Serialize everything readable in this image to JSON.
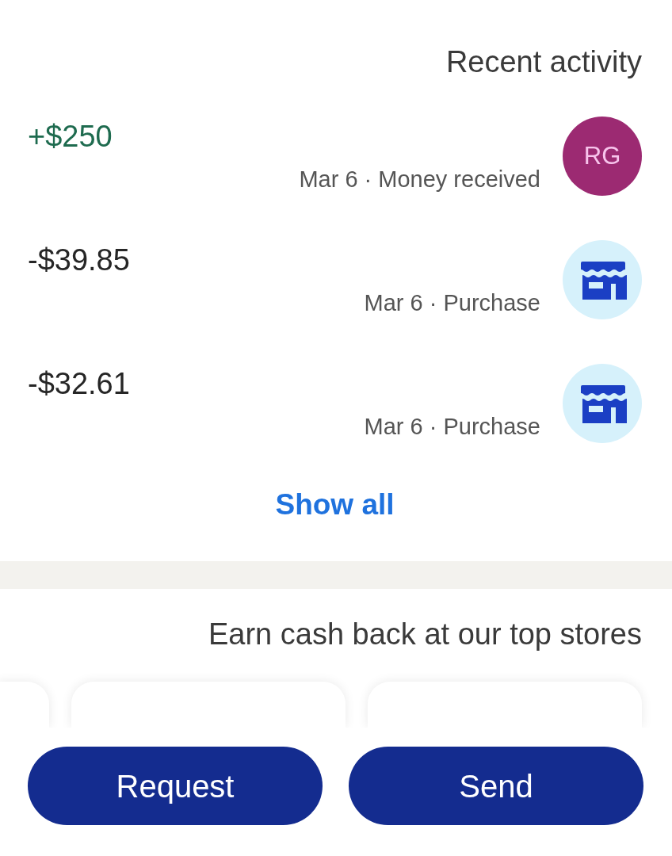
{
  "recent_activity": {
    "title": "Recent activity",
    "transactions": [
      {
        "kind": "person",
        "initials": "RG",
        "color": "#9c2a72",
        "amount": "+$250",
        "credit": true,
        "subtitle": "Mar 6 · Money received"
      },
      {
        "kind": "store",
        "amount": "-$39.85",
        "credit": false,
        "subtitle": "Mar 6 · Purchase"
      },
      {
        "kind": "store",
        "amount": "-$32.61",
        "credit": false,
        "subtitle": "Mar 6 · Purchase"
      }
    ],
    "show_all": "Show all"
  },
  "promo": {
    "title": "Earn cash back at our top stores"
  },
  "buttons": [
    "Request",
    "Send"
  ]
}
